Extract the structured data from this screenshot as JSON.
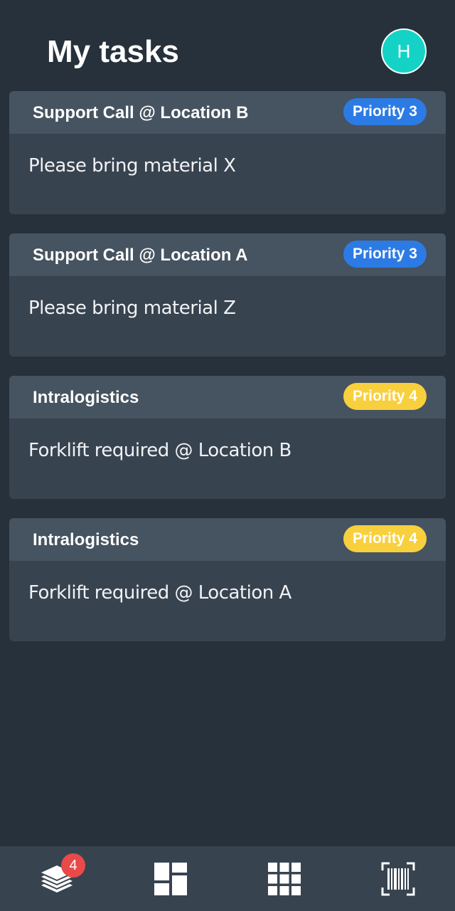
{
  "header": {
    "title": "My tasks",
    "avatar_initial": "H"
  },
  "tasks": [
    {
      "title": "Support Call @ Location B",
      "priority": "Priority 3",
      "priority_color": "#2c7be5",
      "description": "Please bring material X"
    },
    {
      "title": "Support Call @ Location A",
      "priority": "Priority 3",
      "priority_color": "#2c7be5",
      "description": "Please bring material Z"
    },
    {
      "title": "Intralogistics",
      "priority": "Priority 4",
      "priority_color": "#f8d03e",
      "description": "Forklift required @ Location B"
    },
    {
      "title": "Intralogistics",
      "priority": "Priority 4",
      "priority_color": "#f8d03e",
      "description": "Forklift required @ Location A"
    }
  ],
  "bottom_nav": {
    "items": [
      {
        "icon": "layers-icon",
        "badge": "4"
      },
      {
        "icon": "dashboard-icon"
      },
      {
        "icon": "grid-apps-icon"
      },
      {
        "icon": "barcode-scan-icon"
      }
    ]
  },
  "colors": {
    "background": "#27313b",
    "card": "#384350",
    "card_header": "#465360",
    "avatar": "#14d3c6",
    "badge_red": "#e84a4a"
  }
}
